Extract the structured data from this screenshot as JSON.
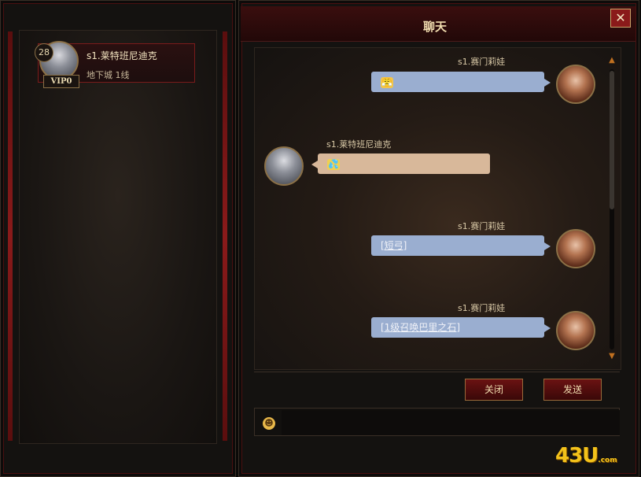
{
  "window": {
    "title": "聊天",
    "close_label": "✕"
  },
  "friend_list": {
    "items": [
      {
        "level": "28",
        "vip": "VIP0",
        "name": "s1.莱特班尼迪克",
        "location": "地下城 1线"
      }
    ]
  },
  "messages": [
    {
      "sender": "s1.赛门莉娃",
      "side": "right",
      "content": "😤",
      "emoji": "grin-emoji"
    },
    {
      "sender": "s1.莱特班尼迪克",
      "side": "left",
      "content": "💦",
      "emoji": "sweat-emoji"
    },
    {
      "sender": "s1.赛门莉娃",
      "side": "right",
      "content": "[短弓]",
      "link": true
    },
    {
      "sender": "s1.赛门莉娃",
      "side": "right",
      "content": "[1级召唤巴里之石]",
      "link": true
    }
  ],
  "buttons": {
    "close_label": "关闭",
    "send_label": "发送"
  },
  "input": {
    "value": "",
    "placeholder": ""
  },
  "watermark": {
    "logo": "43U",
    "suffix": ".com"
  },
  "colors": {
    "accent": "#8a1a1a",
    "bubble_self": "#9aaed0",
    "bubble_other": "#d8b89a"
  }
}
